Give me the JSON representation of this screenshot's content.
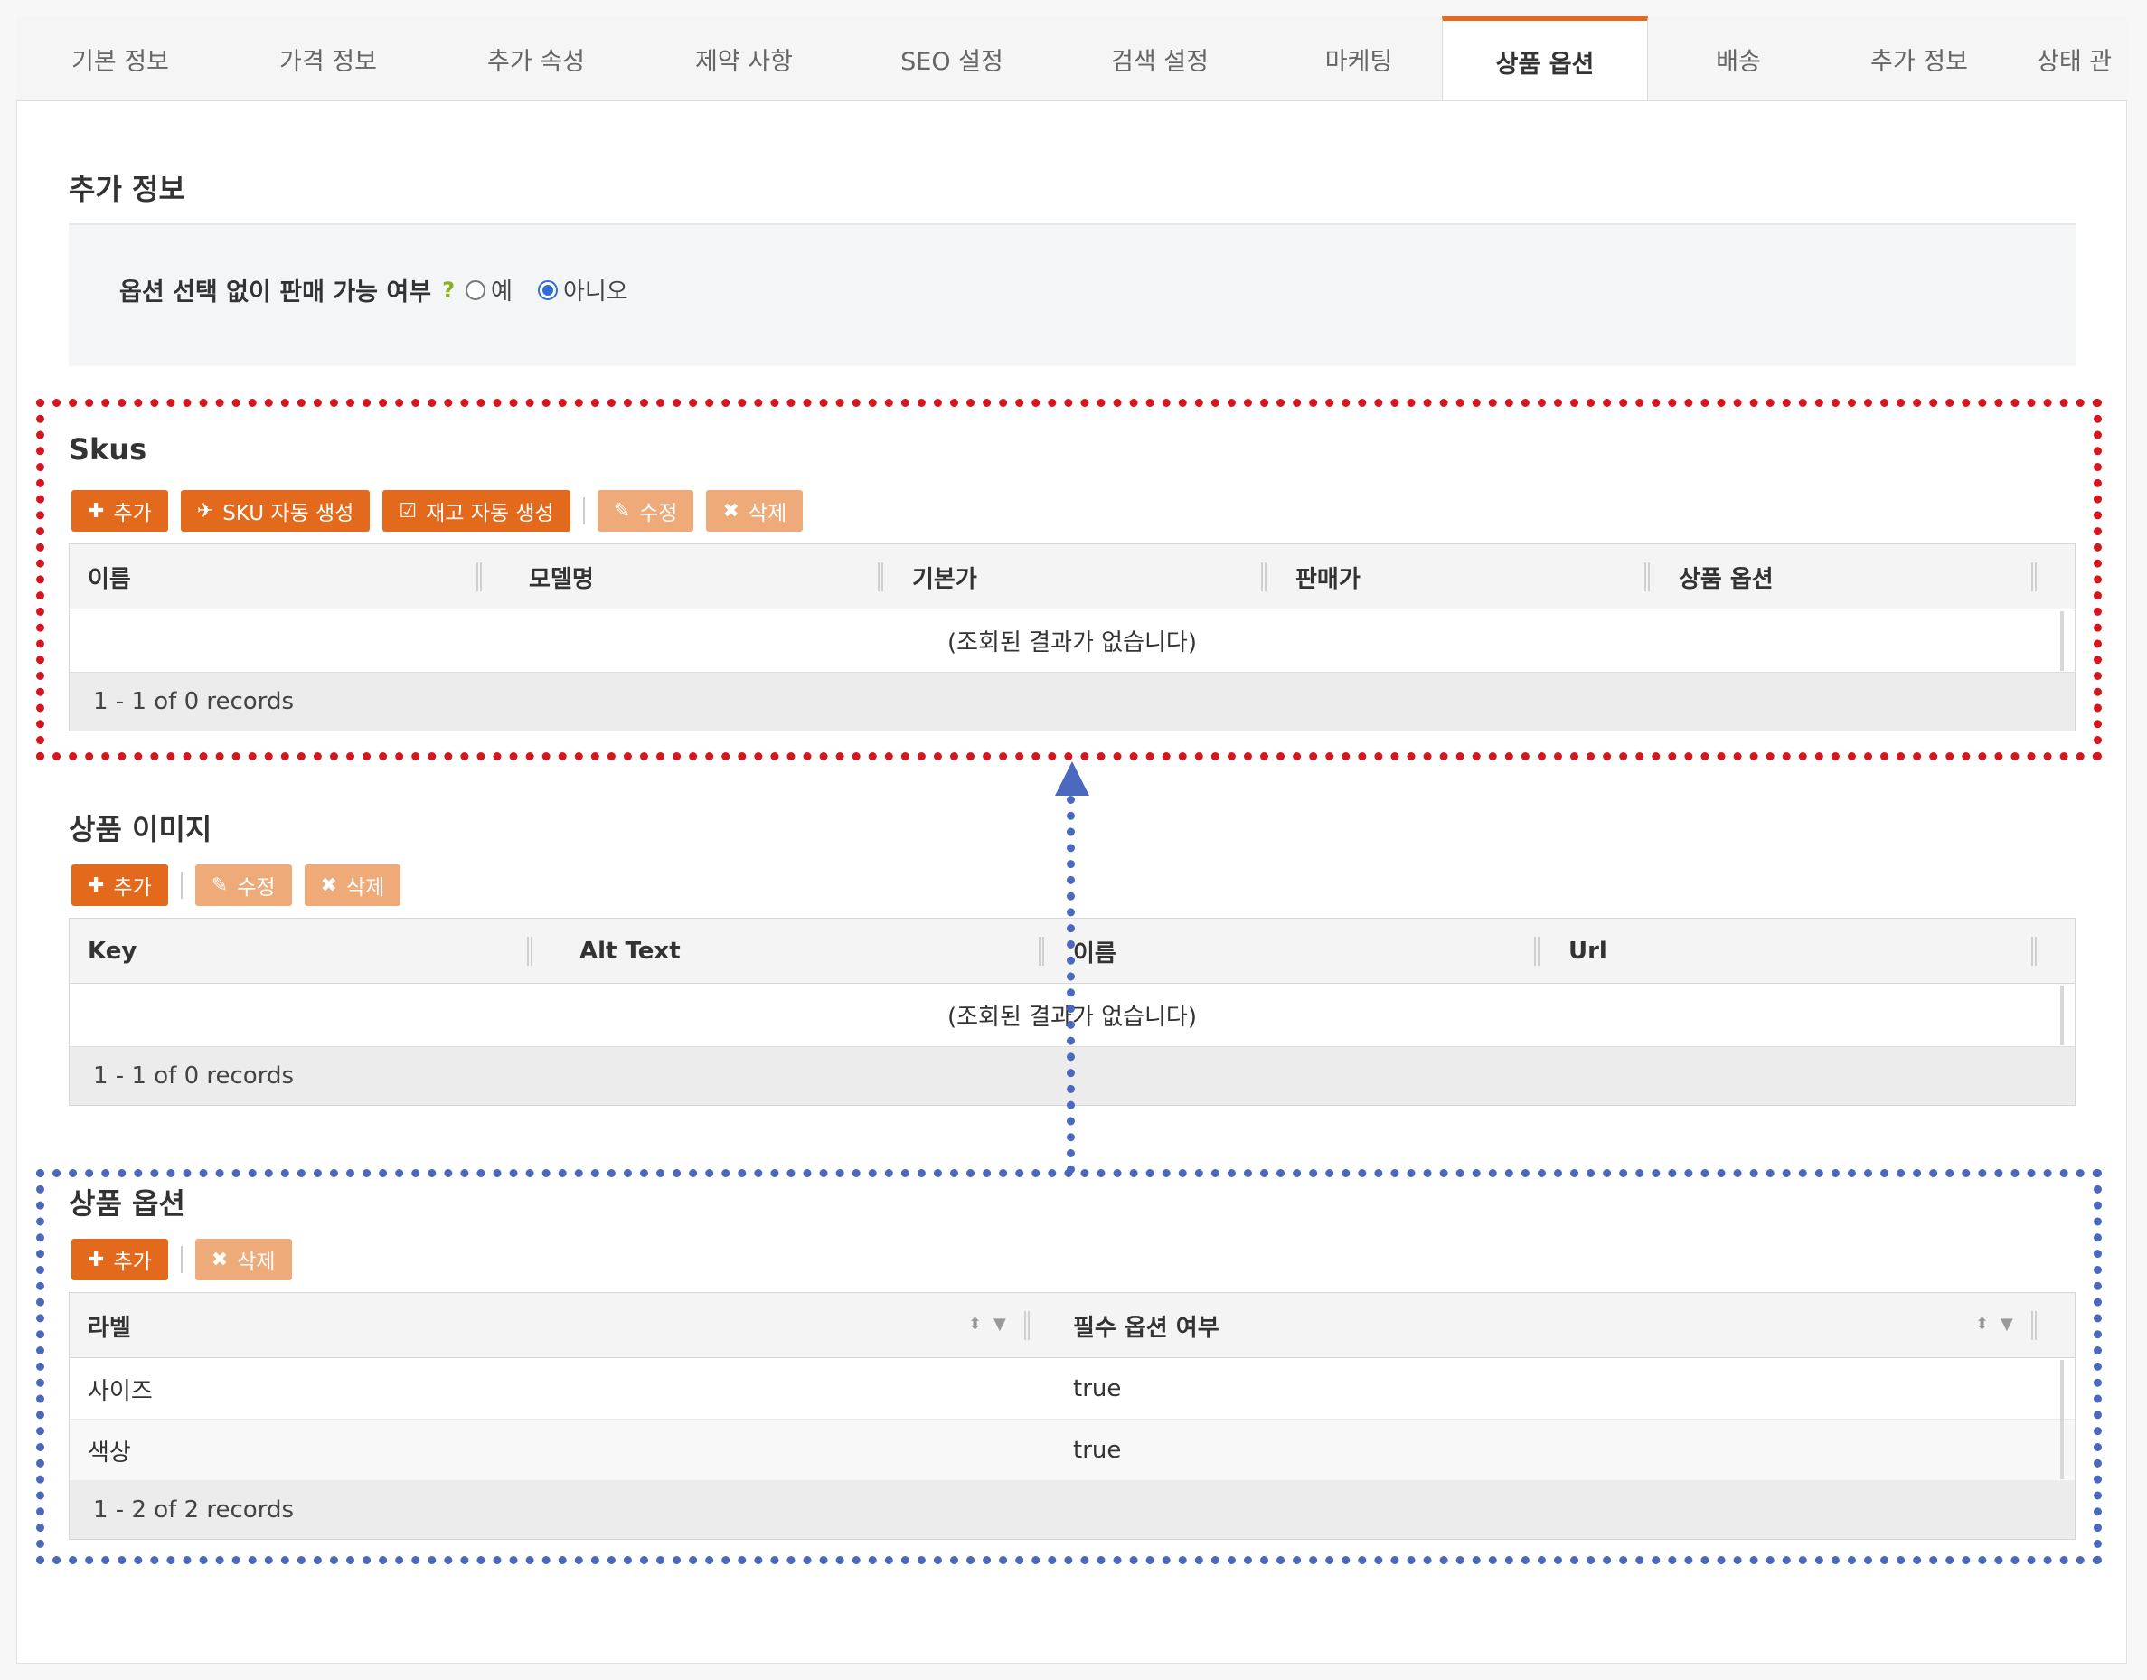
{
  "tabs": [
    {
      "label": "기본 정보",
      "active": false
    },
    {
      "label": "가격 정보",
      "active": false
    },
    {
      "label": "추가 속성",
      "active": false
    },
    {
      "label": "제약 사항",
      "active": false
    },
    {
      "label": "SEO 설정",
      "active": false
    },
    {
      "label": "검색 설정",
      "active": false
    },
    {
      "label": "마케팅",
      "active": false
    },
    {
      "label": "상품 옵션",
      "active": true
    },
    {
      "label": "배송",
      "active": false
    },
    {
      "label": "추가 정보",
      "active": false
    },
    {
      "label": "상태 관",
      "active": false
    }
  ],
  "additional_info": {
    "title": "추가 정보",
    "question": "옵션 선택 없이 판매 가능 여부",
    "help": "?",
    "option_yes": "예",
    "option_no": "아니오",
    "selected": "아니오"
  },
  "skus": {
    "title": "Skus",
    "buttons": {
      "add": "추가",
      "auto_sku": "SKU 자동 생성",
      "auto_stock": "재고 자동 생성",
      "edit": "수정",
      "delete": "삭제"
    },
    "columns": [
      "이름",
      "모델명",
      "기본가",
      "판매가",
      "상품 옵션"
    ],
    "empty_text": "(조회된 결과가 없습니다)",
    "footer": "1 - 1 of 0 records"
  },
  "images": {
    "title": "상품 이미지",
    "buttons": {
      "add": "추가",
      "edit": "수정",
      "delete": "삭제"
    },
    "columns": [
      "Key",
      "Alt Text",
      "이름",
      "Url"
    ],
    "empty_text": "(조회된 결과가 없습니다)",
    "footer": "1 - 1 of 0 records"
  },
  "options": {
    "title": "상품 옵션",
    "buttons": {
      "add": "추가",
      "delete": "삭제"
    },
    "columns": [
      "라벨",
      "필수 옵션 여부"
    ],
    "rows": [
      {
        "label": "사이즈",
        "required": "true"
      },
      {
        "label": "색상",
        "required": "true"
      }
    ],
    "footer": "1 - 2 of 2 records"
  },
  "colors": {
    "accent": "#e36a1c",
    "accent_light": "#eeaa78",
    "highlight_red": "#d4161e",
    "highlight_blue": "#4a69bd"
  }
}
